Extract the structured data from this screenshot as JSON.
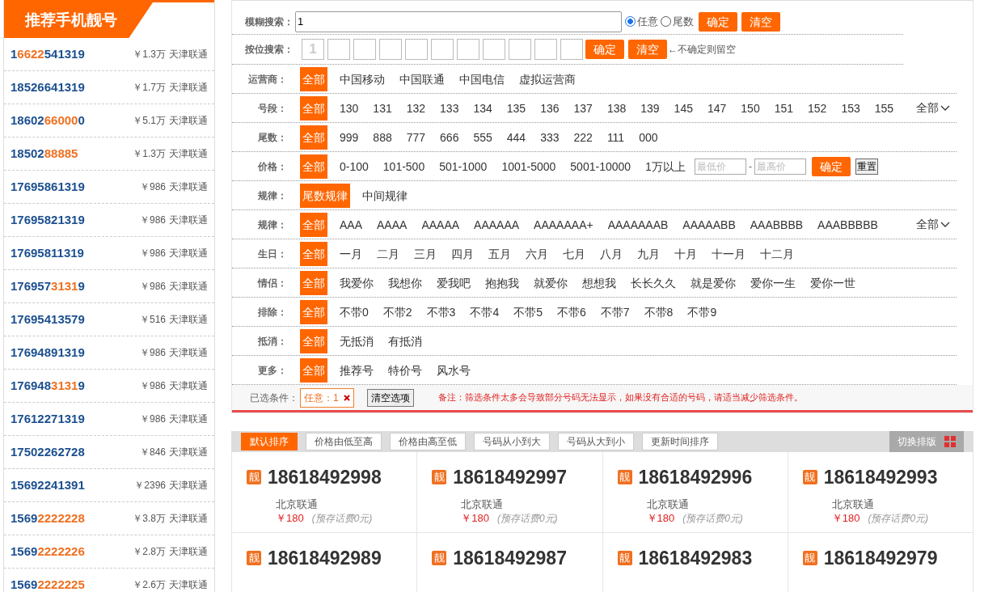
{
  "sidebar": {
    "title": "推荐手机靓号",
    "items": [
      {
        "parts": [
          {
            "text": "1",
            "highlight": false
          },
          {
            "text": "6622",
            "highlight": true
          },
          {
            "text": "541319",
            "highlight": false
          }
        ],
        "price": "￥1.3万",
        "carrier": "天津联通"
      },
      {
        "parts": [
          {
            "text": "18526641319",
            "highlight": false
          }
        ],
        "price": "￥1.7万",
        "carrier": "天津联通"
      },
      {
        "parts": [
          {
            "text": "18602",
            "highlight": false
          },
          {
            "text": "66000",
            "highlight": true
          },
          {
            "text": "0",
            "highlight": false
          }
        ],
        "price": "￥5.1万",
        "carrier": "天津联通"
      },
      {
        "parts": [
          {
            "text": "18502",
            "highlight": false
          },
          {
            "text": "88885",
            "highlight": true
          }
        ],
        "price": "￥1.3万",
        "carrier": "天津联通"
      },
      {
        "parts": [
          {
            "text": "17695861319",
            "highlight": false
          }
        ],
        "price": "￥986",
        "carrier": "天津联通"
      },
      {
        "parts": [
          {
            "text": "17695821319",
            "highlight": false
          }
        ],
        "price": "￥986",
        "carrier": "天津联通"
      },
      {
        "parts": [
          {
            "text": "17695811319",
            "highlight": false
          }
        ],
        "price": "￥986",
        "carrier": "天津联通"
      },
      {
        "parts": [
          {
            "text": "176957",
            "highlight": false
          },
          {
            "text": "3131",
            "highlight": true
          },
          {
            "text": "9",
            "highlight": false
          }
        ],
        "price": "￥986",
        "carrier": "天津联通"
      },
      {
        "parts": [
          {
            "text": "17695413579",
            "highlight": false
          }
        ],
        "price": "￥516",
        "carrier": "天津联通"
      },
      {
        "parts": [
          {
            "text": "17694891319",
            "highlight": false
          }
        ],
        "price": "￥986",
        "carrier": "天津联通"
      },
      {
        "parts": [
          {
            "text": "176948",
            "highlight": false
          },
          {
            "text": "3131",
            "highlight": true
          },
          {
            "text": "9",
            "highlight": false
          }
        ],
        "price": "￥986",
        "carrier": "天津联通"
      },
      {
        "parts": [
          {
            "text": "17612271319",
            "highlight": false
          }
        ],
        "price": "￥986",
        "carrier": "天津联通"
      },
      {
        "parts": [
          {
            "text": "17502262728",
            "highlight": false
          }
        ],
        "price": "￥846",
        "carrier": "天津联通"
      },
      {
        "parts": [
          {
            "text": "15692241391",
            "highlight": false
          }
        ],
        "price": "￥2396",
        "carrier": "天津联通"
      },
      {
        "parts": [
          {
            "text": "1569",
            "highlight": false
          },
          {
            "text": "2222228",
            "highlight": true
          }
        ],
        "price": "￥3.8万",
        "carrier": "天津联通"
      },
      {
        "parts": [
          {
            "text": "1569",
            "highlight": false
          },
          {
            "text": "2222226",
            "highlight": true
          }
        ],
        "price": "￥2.8万",
        "carrier": "天津联通"
      },
      {
        "parts": [
          {
            "text": "1569",
            "highlight": false
          },
          {
            "text": "2222225",
            "highlight": true
          }
        ],
        "price": "￥2.6万",
        "carrier": "天津联通"
      }
    ]
  },
  "fuzzy_search": {
    "label": "模糊搜索：",
    "value": "1",
    "options": [
      {
        "label": "任意",
        "selected": true
      },
      {
        "label": "尾数",
        "selected": false
      }
    ],
    "confirm": "确定",
    "clear": "清空"
  },
  "position_search": {
    "label": "按位搜索：",
    "boxes": [
      {
        "placeholder": "1"
      },
      {
        "kind": "digit"
      },
      {
        "kind": "digit"
      },
      {
        "kind": "digit"
      },
      {
        "kind": "digit"
      },
      {
        "kind": "digit"
      },
      {
        "kind": "digit"
      },
      {
        "kind": "digit"
      },
      {
        "kind": "digit"
      },
      {
        "kind": "digit"
      },
      {
        "kind": "digit"
      }
    ],
    "confirm": "确定",
    "clear": "清空",
    "hint": "←不确定则留空"
  },
  "filters": [
    {
      "kind": "options",
      "label": "运营商：",
      "options": [
        {
          "label": "全部",
          "selected": true
        },
        {
          "label": "中国移动",
          "selected": false
        },
        {
          "label": "中国联通",
          "selected": false
        },
        {
          "label": "中国电信",
          "selected": false
        },
        {
          "label": "虚拟运营商",
          "selected": false
        }
      ]
    },
    {
      "kind": "options",
      "label": "号段：",
      "more": "全部",
      "options": [
        {
          "label": "全部",
          "selected": true
        },
        {
          "label": "130",
          "selected": false
        },
        {
          "label": "131",
          "selected": false
        },
        {
          "label": "132",
          "selected": false
        },
        {
          "label": "133",
          "selected": false
        },
        {
          "label": "134",
          "selected": false
        },
        {
          "label": "135",
          "selected": false
        },
        {
          "label": "136",
          "selected": false
        },
        {
          "label": "137",
          "selected": false
        },
        {
          "label": "138",
          "selected": false
        },
        {
          "label": "139",
          "selected": false
        },
        {
          "label": "145",
          "selected": false
        },
        {
          "label": "147",
          "selected": false
        },
        {
          "label": "150",
          "selected": false
        },
        {
          "label": "151",
          "selected": false
        },
        {
          "label": "152",
          "selected": false
        },
        {
          "label": "153",
          "selected": false
        },
        {
          "label": "155",
          "selected": false
        }
      ]
    },
    {
      "kind": "options",
      "label": "尾数：",
      "options": [
        {
          "label": "全部",
          "selected": true
        },
        {
          "label": "999",
          "selected": false
        },
        {
          "label": "888",
          "selected": false
        },
        {
          "label": "777",
          "selected": false
        },
        {
          "label": "666",
          "selected": false
        },
        {
          "label": "555",
          "selected": false
        },
        {
          "label": "444",
          "selected": false
        },
        {
          "label": "333",
          "selected": false
        },
        {
          "label": "222",
          "selected": false
        },
        {
          "label": "111",
          "selected": false
        },
        {
          "label": "000",
          "selected": false
        }
      ]
    },
    {
      "kind": "price",
      "label": "价格：",
      "options": [
        {
          "label": "全部",
          "selected": true
        },
        {
          "label": "0-100",
          "selected": false
        },
        {
          "label": "101-500",
          "selected": false
        },
        {
          "label": "501-1000",
          "selected": false
        },
        {
          "label": "1001-5000",
          "selected": false
        },
        {
          "label": "5001-10000",
          "selected": false
        },
        {
          "label": "1万以上",
          "selected": false
        }
      ],
      "min_placeholder": "最低价",
      "dash": "-",
      "max_placeholder": "最高价",
      "confirm": "确定",
      "reset": "重置"
    },
    {
      "kind": "options",
      "label": "规律：",
      "options": [
        {
          "label": "尾数规律",
          "selected": true
        },
        {
          "label": "中间规律",
          "selected": false
        }
      ]
    },
    {
      "kind": "options",
      "label": "规律：",
      "more": "全部",
      "options": [
        {
          "label": "全部",
          "selected": true
        },
        {
          "label": "AAA",
          "selected": false
        },
        {
          "label": "AAAA",
          "selected": false
        },
        {
          "label": "AAAAA",
          "selected": false
        },
        {
          "label": "AAAAAA",
          "selected": false
        },
        {
          "label": "AAAAAAA+",
          "selected": false
        },
        {
          "label": "AAAAAAAB",
          "selected": false
        },
        {
          "label": "AAAAABB",
          "selected": false
        },
        {
          "label": "AAABBBB",
          "selected": false
        },
        {
          "label": "AAABBBBB",
          "selected": false
        }
      ]
    },
    {
      "kind": "options",
      "label": "生日：",
      "options": [
        {
          "label": "全部",
          "selected": true
        },
        {
          "label": "一月",
          "selected": false
        },
        {
          "label": "二月",
          "selected": false
        },
        {
          "label": "三月",
          "selected": false
        },
        {
          "label": "四月",
          "selected": false
        },
        {
          "label": "五月",
          "selected": false
        },
        {
          "label": "六月",
          "selected": false
        },
        {
          "label": "七月",
          "selected": false
        },
        {
          "label": "八月",
          "selected": false
        },
        {
          "label": "九月",
          "selected": false
        },
        {
          "label": "十月",
          "selected": false
        },
        {
          "label": "十一月",
          "selected": false
        },
        {
          "label": "十二月",
          "selected": false
        }
      ]
    },
    {
      "kind": "options",
      "label": "情侣：",
      "options": [
        {
          "label": "全部",
          "selected": true
        },
        {
          "label": "我爱你",
          "selected": false
        },
        {
          "label": "我想你",
          "selected": false
        },
        {
          "label": "爱我吧",
          "selected": false
        },
        {
          "label": "抱抱我",
          "selected": false
        },
        {
          "label": "就爱你",
          "selected": false
        },
        {
          "label": "想想我",
          "selected": false
        },
        {
          "label": "长长久久",
          "selected": false
        },
        {
          "label": "就是爱你",
          "selected": false
        },
        {
          "label": "爱你一生",
          "selected": false
        },
        {
          "label": "爱你一世",
          "selected": false
        }
      ]
    },
    {
      "kind": "options",
      "label": "排除：",
      "options": [
        {
          "label": "全部",
          "selected": true
        },
        {
          "label": "不带0",
          "selected": false
        },
        {
          "label": "不带2",
          "selected": false
        },
        {
          "label": "不带3",
          "selected": false
        },
        {
          "label": "不带4",
          "selected": false
        },
        {
          "label": "不带5",
          "selected": false
        },
        {
          "label": "不带6",
          "selected": false
        },
        {
          "label": "不带7",
          "selected": false
        },
        {
          "label": "不带8",
          "selected": false
        },
        {
          "label": "不带9",
          "selected": false
        }
      ]
    },
    {
      "kind": "options",
      "label": "抵消：",
      "options": [
        {
          "label": "全部",
          "selected": true
        },
        {
          "label": "无抵消",
          "selected": false
        },
        {
          "label": "有抵消",
          "selected": false
        }
      ]
    },
    {
      "kind": "options",
      "label": "更多：",
      "options": [
        {
          "label": "全部",
          "selected": true
        },
        {
          "label": "推荐号",
          "selected": false
        },
        {
          "label": "特价号",
          "selected": false
        },
        {
          "label": "风水号",
          "selected": false
        }
      ]
    }
  ],
  "selected_conditions": {
    "label": "已选条件：",
    "tags": [
      {
        "text": "任意：1"
      }
    ],
    "clear": "清空选项",
    "note": "备注：筛选条件太多会导致部分号码无法显示，如果没有合适的号码，请适当减少筛选条件。"
  },
  "sort_bar": {
    "options": [
      {
        "label": "默认排序",
        "selected": true
      },
      {
        "label": "价格由低至高",
        "selected": false
      },
      {
        "label": "价格由高至低",
        "selected": false
      },
      {
        "label": "号码从小到大",
        "selected": false
      },
      {
        "label": "号码从大到小",
        "selected": false
      },
      {
        "label": "更新时间排序",
        "selected": false
      }
    ],
    "switch_layout": "切换排版"
  },
  "cards": [
    {
      "badge": "靓",
      "number": "18618492998",
      "carrier": "北京联通",
      "price": "￥180",
      "note": "(预存话费0元)"
    },
    {
      "badge": "靓",
      "number": "18618492997",
      "carrier": "北京联通",
      "price": "￥180",
      "note": "(预存话费0元)"
    },
    {
      "badge": "靓",
      "number": "18618492996",
      "carrier": "北京联通",
      "price": "￥180",
      "note": "(预存话费0元)"
    },
    {
      "badge": "靓",
      "number": "18618492993",
      "carrier": "北京联通",
      "price": "￥180",
      "note": "(预存话费0元)"
    },
    {
      "badge": "靓",
      "number": "18618492989"
    },
    {
      "badge": "靓",
      "number": "18618492987"
    },
    {
      "badge": "靓",
      "number": "18618492983"
    },
    {
      "badge": "靓",
      "number": "18618492979"
    }
  ]
}
